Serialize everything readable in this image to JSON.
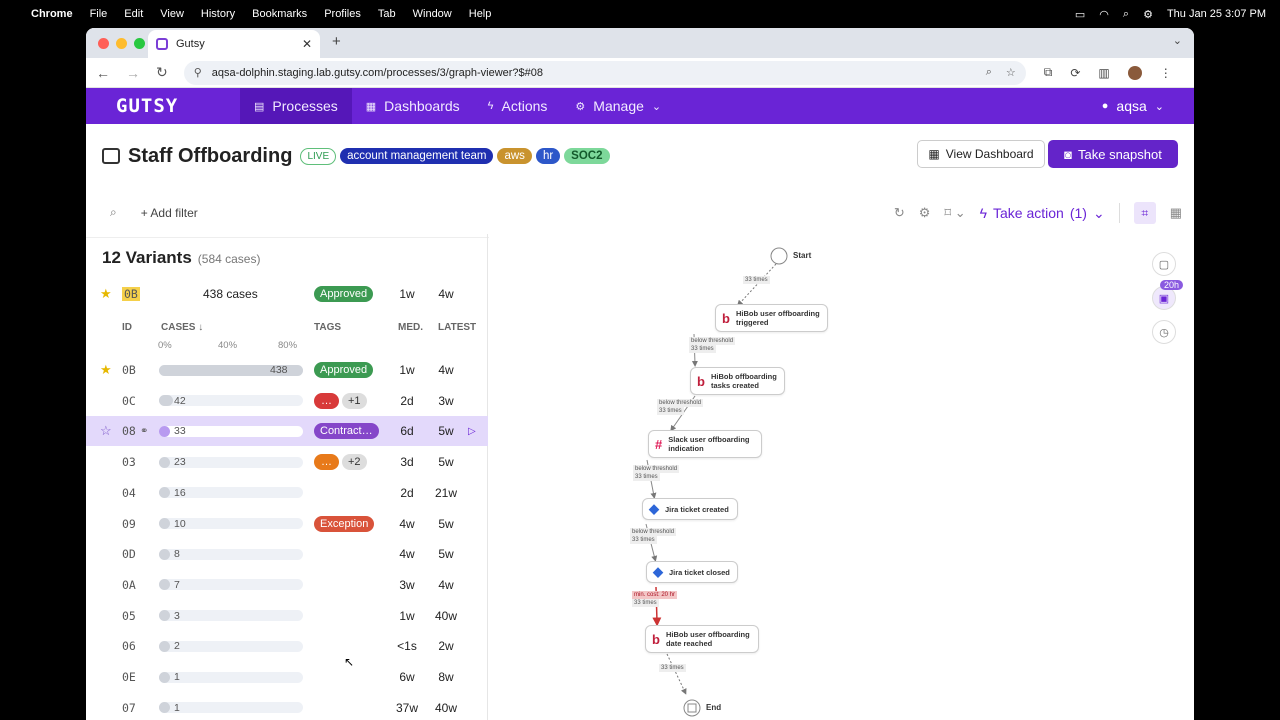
{
  "mac": {
    "apple": "",
    "app": "Chrome",
    "menus": [
      "File",
      "Edit",
      "View",
      "History",
      "Bookmarks",
      "Profiles",
      "Tab",
      "Window",
      "Help"
    ],
    "clock": "Thu Jan 25  3:07 PM"
  },
  "browser": {
    "tab_title": "Gutsy",
    "url": "aqsa-dolphin.staging.lab.gutsy.com/processes/3/graph-viewer?$#08"
  },
  "nav": {
    "logo": "GUTSY",
    "items": [
      "Processes",
      "Dashboards",
      "Actions",
      "Manage"
    ],
    "user": "aqsa"
  },
  "header": {
    "title": "Staff Offboarding",
    "live": "LIVE",
    "tags": [
      "account management team",
      "aws",
      "hr",
      "SOC2"
    ],
    "view_dashboard": "View Dashboard",
    "take_snapshot": "Take snapshot"
  },
  "filter": {
    "add_filter": "Add filter",
    "take_action": "Take action",
    "take_action_count": "(1)"
  },
  "variants": {
    "title": "12 Variants",
    "subtitle": "(584 cases)",
    "pinned": {
      "id": "0B",
      "cases": "438 cases",
      "tag": "Approved",
      "med": "1w",
      "latest": "4w"
    },
    "columns": {
      "id": "ID",
      "cases": "CASES ↓",
      "tags": "TAGS",
      "med": "MED.",
      "latest": "LATEST"
    },
    "pct_labels": [
      "0%",
      "40%",
      "80%"
    ],
    "rows": [
      {
        "id": "0B",
        "count": "438",
        "fraction": 1.0,
        "tag": "Approved",
        "tag_type": "ap",
        "med": "1w",
        "latest": "4w",
        "star": "★"
      },
      {
        "id": "0C",
        "count": "42",
        "fraction": 0.096,
        "tag": "…",
        "tag_type": "rd",
        "extra": "+1",
        "med": "2d",
        "latest": "3w"
      },
      {
        "id": "08",
        "count": "33",
        "fraction": 0.075,
        "tag": "Contract…",
        "tag_type": "ct",
        "med": "6d",
        "latest": "5w",
        "star": "☆",
        "selected": true
      },
      {
        "id": "03",
        "count": "23",
        "fraction": 0.052,
        "tag": "…",
        "tag_type": "or",
        "extra": "+2",
        "med": "3d",
        "latest": "5w"
      },
      {
        "id": "04",
        "count": "16",
        "fraction": 0.036,
        "med": "2d",
        "latest": "21w"
      },
      {
        "id": "09",
        "count": "10",
        "fraction": 0.023,
        "tag": "Exception",
        "tag_type": "ex",
        "med": "4w",
        "latest": "5w"
      },
      {
        "id": "0D",
        "count": "8",
        "fraction": 0.018,
        "med": "4w",
        "latest": "5w"
      },
      {
        "id": "0A",
        "count": "7",
        "fraction": 0.016,
        "med": "3w",
        "latest": "4w"
      },
      {
        "id": "05",
        "count": "3",
        "fraction": 0.007,
        "med": "1w",
        "latest": "40w"
      },
      {
        "id": "06",
        "count": "2",
        "fraction": 0.005,
        "med": "<1s",
        "latest": "2w"
      },
      {
        "id": "0E",
        "count": "1",
        "fraction": 0.002,
        "med": "6w",
        "latest": "8w"
      },
      {
        "id": "07",
        "count": "1",
        "fraction": 0.002,
        "med": "37w",
        "latest": "40w"
      }
    ]
  },
  "graph": {
    "start": "Start",
    "end": "End",
    "nodes": [
      {
        "label": "HiBob user offboarding triggered",
        "icon": "b"
      },
      {
        "label": "HiBob offboarding tasks created",
        "icon": "b"
      },
      {
        "label": "Slack user offboarding indication",
        "icon": "#"
      },
      {
        "label": "Jira ticket created",
        "icon": "◆"
      },
      {
        "label": "Jira ticket closed",
        "icon": "◆"
      },
      {
        "label": "HiBob user offboarding date reached",
        "icon": "b"
      }
    ],
    "edges": [
      {
        "l1": "33 times"
      },
      {
        "l1": "below threshold",
        "l2": "33 times"
      },
      {
        "l1": "below threshold",
        "l2": "33 times"
      },
      {
        "l1": "below threshold",
        "l2": "33 times"
      },
      {
        "l1": "below threshold",
        "l2": "33 times"
      },
      {
        "l1": "min. cost: 20 hr",
        "l2": "33 times",
        "red": true
      },
      {
        "l1": "33 times"
      }
    ],
    "side_badge": "20h"
  }
}
